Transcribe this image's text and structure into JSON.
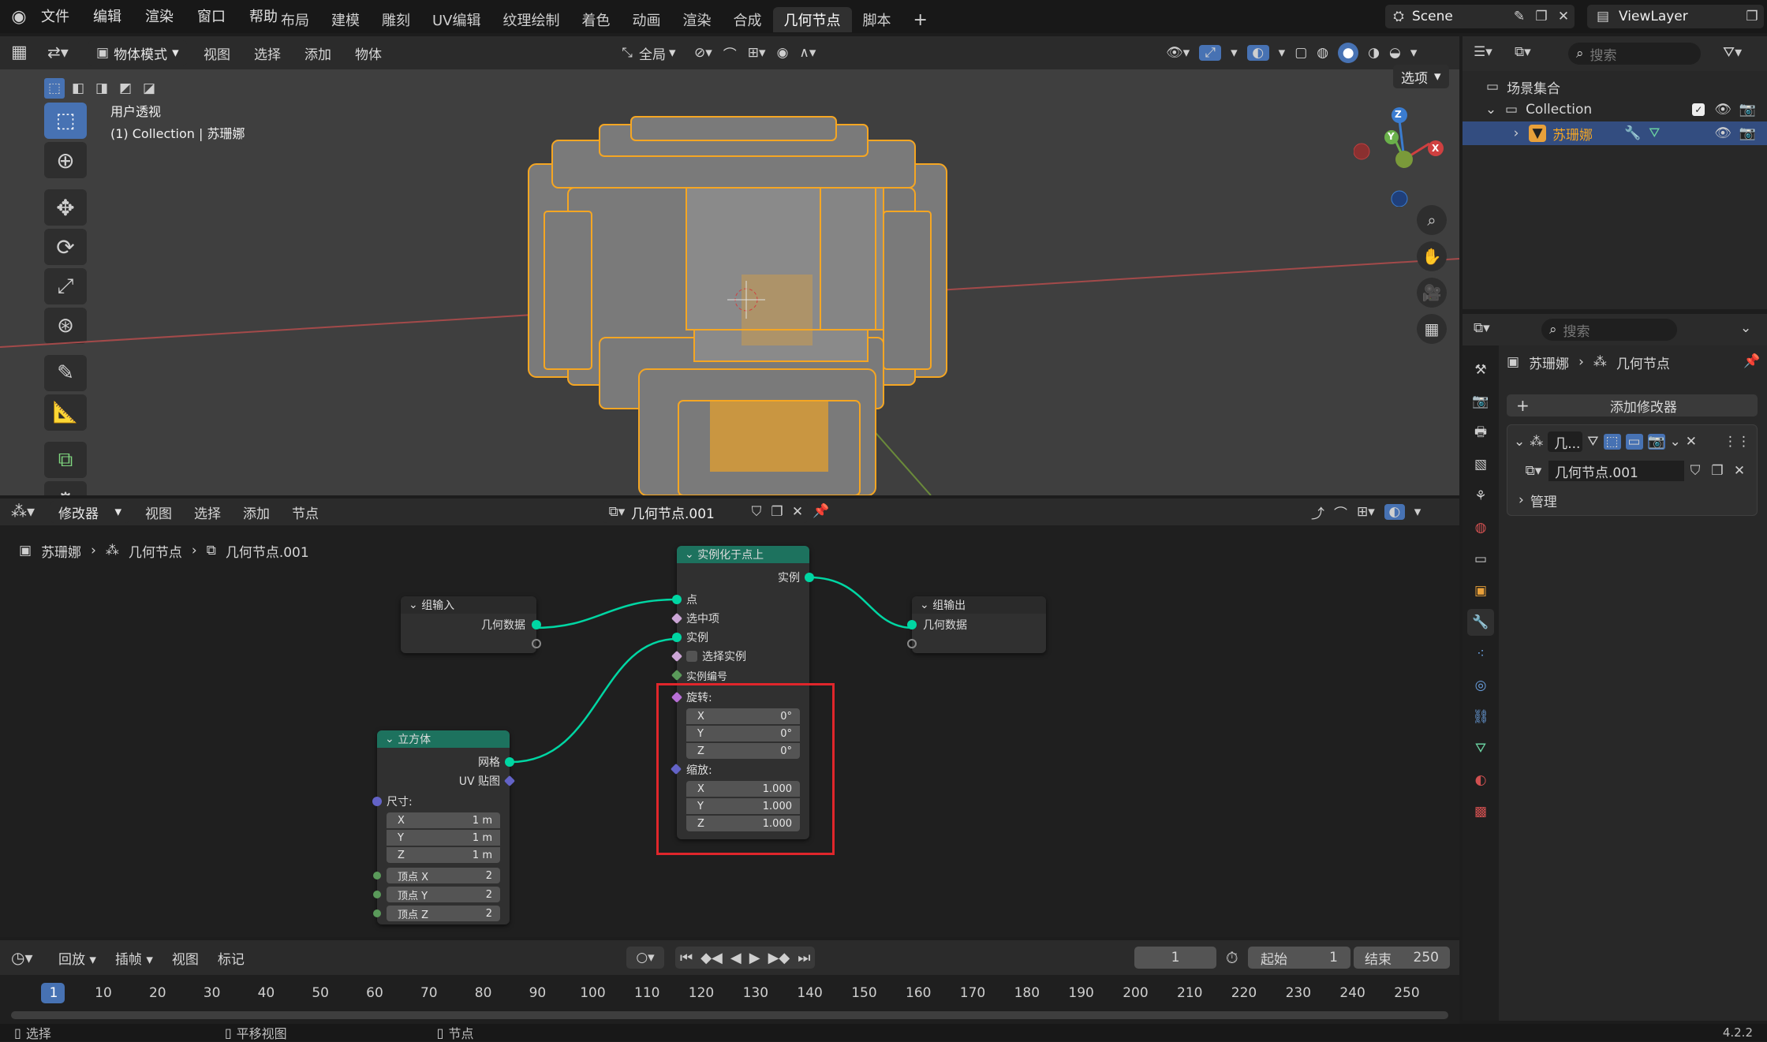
{
  "topbar": {
    "menus": [
      "文件",
      "编辑",
      "渲染",
      "窗口",
      "帮助"
    ],
    "workspaces": [
      "布局",
      "建模",
      "雕刻",
      "UV编辑",
      "纹理绘制",
      "着色",
      "动画",
      "渲染",
      "合成",
      "几何节点",
      "脚本"
    ],
    "active_workspace": "几何节点",
    "scene_name": "Scene",
    "view_layer": "ViewLayer"
  },
  "viewport": {
    "mode": "物体模式",
    "menus": [
      "视图",
      "选择",
      "添加",
      "物体"
    ],
    "transform_orientation": "全局",
    "view_name": "用户透视",
    "collection_info": "(1) Collection | 苏珊娜",
    "options_label": "选项",
    "gizmo": {
      "x": "X",
      "y": "Y",
      "z": "Z"
    }
  },
  "node_editor": {
    "editor_type": "修改器",
    "menus": [
      "视图",
      "选择",
      "添加",
      "节点"
    ],
    "node_group_name": "几何节点.001",
    "breadcrumb": [
      "苏珊娜",
      "几何节点",
      "几何节点.001"
    ],
    "nodes": {
      "group_input": {
        "title": "组输入",
        "out_geometry": "几何数据"
      },
      "group_output": {
        "title": "组输出",
        "in_geometry": "几何数据"
      },
      "instance_on_points": {
        "title": "实例化于点上",
        "out_instances": "实例",
        "in_points": "点",
        "in_selection": "选中项",
        "in_instance": "实例",
        "in_pick_instance": "选择实例",
        "in_instance_index": "实例编号",
        "rotation_label": "旋转:",
        "rotation": [
          {
            "axis": "X",
            "value": "0°"
          },
          {
            "axis": "Y",
            "value": "0°"
          },
          {
            "axis": "Z",
            "value": "0°"
          }
        ],
        "scale_label": "缩放:",
        "scale": [
          {
            "axis": "X",
            "value": "1.000"
          },
          {
            "axis": "Y",
            "value": "1.000"
          },
          {
            "axis": "Z",
            "value": "1.000"
          }
        ]
      },
      "cube": {
        "title": "立方体",
        "out_mesh": "网格",
        "out_uv": "UV 贴图",
        "size_label": "尺寸:",
        "size": [
          {
            "axis": "X",
            "value": "1 m"
          },
          {
            "axis": "Y",
            "value": "1 m"
          },
          {
            "axis": "Z",
            "value": "1 m"
          }
        ],
        "vertices": [
          {
            "label": "顶点 X",
            "value": "2"
          },
          {
            "label": "顶点 Y",
            "value": "2"
          },
          {
            "label": "顶点 Z",
            "value": "2"
          }
        ]
      }
    },
    "highlight_color": "#e0262b"
  },
  "timeline": {
    "menus": [
      "回放",
      "插帧",
      "视图",
      "标记"
    ],
    "current_frame": "1",
    "start_label": "起始",
    "start": "1",
    "end_label": "结束",
    "end": "250",
    "ruler": [
      "1",
      "10",
      "20",
      "30",
      "40",
      "50",
      "60",
      "70",
      "80",
      "90",
      "100",
      "110",
      "120",
      "130",
      "140",
      "150",
      "160",
      "170",
      "180",
      "190",
      "200",
      "210",
      "220",
      "230",
      "240",
      "250"
    ]
  },
  "statusbar": {
    "select": "选择",
    "pan": "平移视图",
    "node": "节点",
    "version": "4.2.2"
  },
  "outliner": {
    "search_placeholder": "搜索",
    "scene_collection": "场景集合",
    "collection": "Collection",
    "object": "苏珊娜"
  },
  "properties": {
    "search_placeholder": "搜索",
    "object": "苏珊娜",
    "modifier_path": "几何节点",
    "add_modifier": "添加修改器",
    "modifier_name": "几...",
    "node_group": "几何节点.001",
    "manage": "管理"
  },
  "colors": {
    "accent": "#4772b3",
    "orange": "#f5a623",
    "node_header_green": "#1d725e",
    "node_header_dark": "#2a2a2a"
  }
}
